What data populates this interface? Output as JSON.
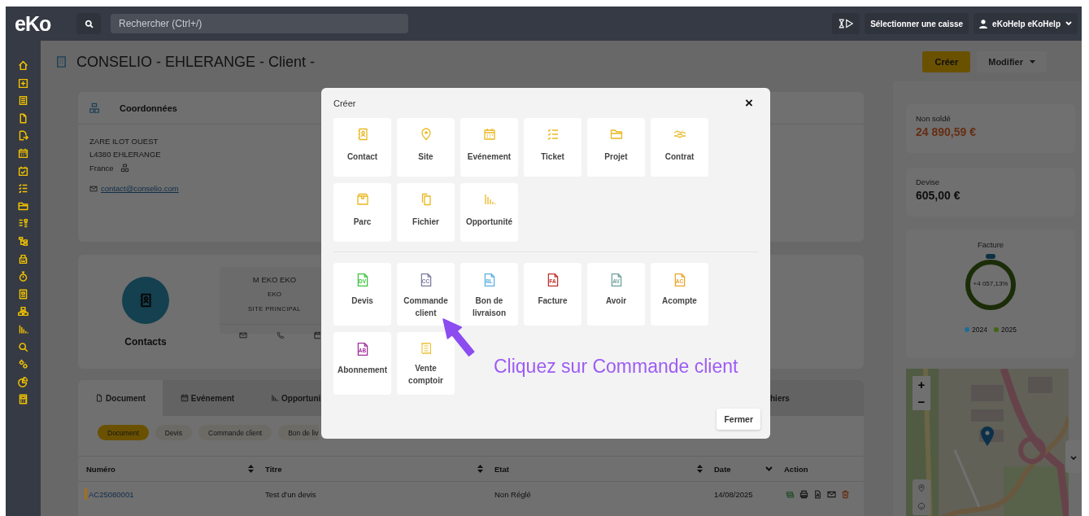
{
  "topbar": {
    "logo": "eKo",
    "search": {
      "placeholder": "Rechercher (Ctrl+/)"
    },
    "register_button": "Sélectionner une caisse",
    "user": "eKoHelp eKoHelp"
  },
  "page": {
    "title": "CONSELIO - EHLERANGE - Client -",
    "actions": [
      {
        "label": "Créer",
        "kind": "primary"
      },
      {
        "label": "Modifier",
        "kind": "dropdown"
      }
    ]
  },
  "coordinates": {
    "title": "Coordonnées",
    "address": [
      "ZARE ILOT OUEST",
      "L4380 EHLERANGE",
      "France"
    ],
    "email": "contact@conselio.com"
  },
  "contacts": {
    "title": "Contacts",
    "card": {
      "name": "M EKO EKO",
      "company": "EKO",
      "site": "SITE PRINCIPAL"
    }
  },
  "tabs": [
    {
      "label": "Document",
      "selected": true
    },
    {
      "label": "Evénement",
      "selected": false
    },
    {
      "label": "Opportuni",
      "selected": false
    },
    {
      "label": "hiers",
      "selected": false
    }
  ],
  "filters": [
    {
      "label": "Document",
      "selected": true
    },
    {
      "label": "Devis",
      "selected": false
    },
    {
      "label": "Commande client",
      "selected": false
    },
    {
      "label": "Bon de liv",
      "selected": false
    }
  ],
  "table": {
    "columns": [
      {
        "label": "Numéro",
        "sorted": false
      },
      {
        "label": "Titre",
        "sorted": false
      },
      {
        "label": "Etat",
        "sorted": false
      },
      {
        "label": "Date",
        "sorted": true
      },
      {
        "label": "Action"
      }
    ],
    "rows": [
      {
        "number": "AC25080001",
        "title": "Test d'un devis",
        "status": "Non Réglé",
        "date": "14/08/2025",
        "color": "#a86e12"
      }
    ]
  },
  "stats": [
    {
      "label": "Non soldé",
      "value": "24 890,59 €",
      "negative": true
    },
    {
      "label": "Devise",
      "value": "605,00 €",
      "negative": false
    }
  ],
  "invoice_chart": {
    "title": "Facture",
    "center": "+4 057,13%",
    "legend": [
      {
        "label": "2024",
        "color": "#1e6d99"
      },
      {
        "label": "2025",
        "color": "#3f6614"
      }
    ]
  },
  "map": {
    "zoom_in": "+",
    "zoom_out": "−"
  },
  "modal": {
    "title": "Créer",
    "close": "×",
    "groups": [
      [
        {
          "label": "Contact",
          "kind": "entity"
        },
        {
          "label": "Site",
          "kind": "entity"
        },
        {
          "label": "Evénement",
          "kind": "entity"
        },
        {
          "label": "Ticket",
          "kind": "entity"
        },
        {
          "label": "Projet",
          "kind": "entity"
        },
        {
          "label": "Contrat",
          "kind": "entity"
        },
        {
          "label": "Parc",
          "kind": "entity"
        },
        {
          "label": "Fichier",
          "kind": "entity"
        },
        {
          "label": "Opportunité",
          "kind": "entity"
        }
      ],
      [
        {
          "label": "Devis",
          "kind": "document",
          "code": "DV",
          "color": "#3cc43c"
        },
        {
          "label": "Commande client",
          "kind": "document",
          "code": "CC",
          "color": "#7a7aa0"
        },
        {
          "label": "Bon de livraison",
          "kind": "document",
          "code": "BL",
          "color": "#5aaee0"
        },
        {
          "label": "Facture",
          "kind": "document",
          "code": "FA",
          "color": "#c0302c"
        },
        {
          "label": "Avoir",
          "kind": "document",
          "code": "AV",
          "color": "#6a9e9a"
        },
        {
          "label": "Acompte",
          "kind": "document",
          "code": "AC",
          "color": "#eba42a"
        },
        {
          "label": "Abonnement",
          "kind": "document",
          "code": "AB",
          "color": "#a0309a"
        },
        {
          "label": "Vente comptoir",
          "kind": "receipt"
        }
      ]
    ],
    "close_button": "Fermer",
    "annotation": "Cliquez sur Commande client"
  }
}
